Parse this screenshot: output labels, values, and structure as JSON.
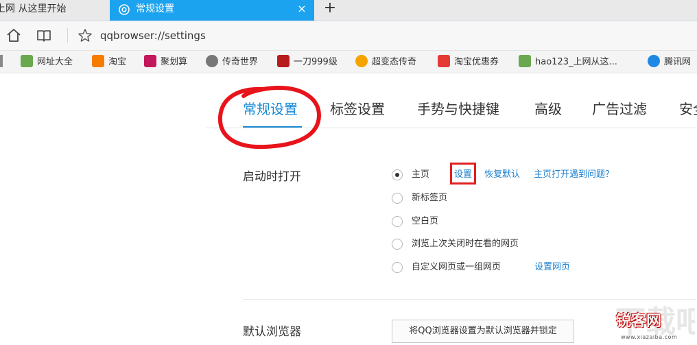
{
  "tabs": {
    "inactive_title": "上网 从这里开始",
    "active_title": "常规设置",
    "close_glyph": "×",
    "new_tab_glyph": "+"
  },
  "toolbar": {
    "address": "qqbrowser://settings"
  },
  "bookmarks": [
    {
      "label": "网址大全",
      "icon": "hao-icon",
      "color": "#6aa84f"
    },
    {
      "label": "淘宝",
      "icon": "taobao-icon",
      "color": "#f57c00"
    },
    {
      "label": "聚划算",
      "icon": "juhuasuan-icon",
      "color": "#c2185b"
    },
    {
      "label": "传奇世界",
      "icon": "legend-icon",
      "color": "#777777"
    },
    {
      "label": "一刀999级",
      "icon": "game-icon",
      "color": "#b71c1c"
    },
    {
      "label": "超变态传奇",
      "icon": "smile-icon",
      "color": "#f4a300"
    },
    {
      "label": "淘宝优惠券",
      "icon": "coupon-icon",
      "color": "#e53935"
    },
    {
      "label": "hao123_上网从这...",
      "icon": "hao123-icon",
      "color": "#6aa84f"
    },
    {
      "label": "腾讯网",
      "icon": "tencent-icon",
      "color": "#1e88e5"
    }
  ],
  "settings_tabs": [
    "常规设置",
    "标签设置",
    "手势与快捷键",
    "高级",
    "广告过滤",
    "安全"
  ],
  "startup": {
    "label": "启动时打开",
    "options": [
      "主页",
      "新标签页",
      "空白页",
      "浏览上次关闭时在看的网页",
      "自定义网页或一组网页"
    ],
    "selected": 0,
    "homepage_links": [
      "设置",
      "恢复默认",
      "主页打开遇到问题？"
    ],
    "custom_link": "设置网页"
  },
  "default_browser": {
    "label": "默认浏览器",
    "button": "将QQ浏览器设置为默认浏览器并锁定"
  },
  "watermark": {
    "text": "锐客网",
    "sub": "www.xiazaiba.com"
  }
}
